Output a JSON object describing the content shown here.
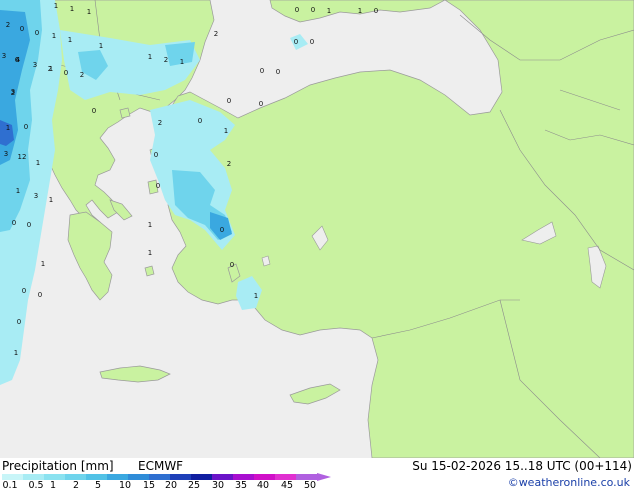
{
  "map": {
    "colors": {
      "sea": "#eeeeee",
      "land": "#c9f2a0",
      "coast": "#9a9a9a",
      "border": "#8c8c8c",
      "precip_light": "#a8ecf4",
      "precip_mid": "#6fd4ec",
      "precip_heavy": "#3aa8e0",
      "precip_max": "#2f6fd0"
    },
    "point_labels": [
      "1",
      "1",
      "1",
      "0",
      "0",
      "1",
      "2",
      "0",
      "0",
      "1",
      "1",
      "3",
      "4",
      "3",
      "1",
      "1",
      "2",
      "0",
      "0",
      "1",
      "2",
      "1",
      "0",
      "0",
      "0",
      "3",
      "6",
      "2",
      "0",
      "2",
      "2",
      "1",
      "0",
      "0",
      "1",
      "0",
      "2",
      "0",
      "0",
      "3",
      "12",
      "1",
      "1",
      "3",
      "1",
      "0",
      "0",
      "1",
      "1",
      "0",
      "1",
      "0",
      "0",
      "0",
      "1",
      "1",
      "0",
      "0",
      "1",
      "0",
      "2"
    ]
  },
  "footer": {
    "title": "Precipitation [mm]",
    "model": "ECMWF",
    "datetime": "Su 15-02-2026 15..18 UTC (00+114)",
    "credit": "©weatheronline.co.uk",
    "legend_ticks": [
      "0.1",
      "0.5",
      "1",
      "2",
      "5",
      "10",
      "15",
      "20",
      "25",
      "30",
      "35",
      "40",
      "45",
      "50"
    ],
    "legend_colors": [
      "#c8f5f8",
      "#a8ecf4",
      "#8ae2f0",
      "#6fd4ec",
      "#52c2e6",
      "#3aa8e0",
      "#2f8cd8",
      "#2f6fd0",
      "#1e3fb8",
      "#101ea0",
      "#6a14c8",
      "#a80fd0",
      "#d010c8",
      "#e030d0",
      "#b060e0"
    ]
  }
}
